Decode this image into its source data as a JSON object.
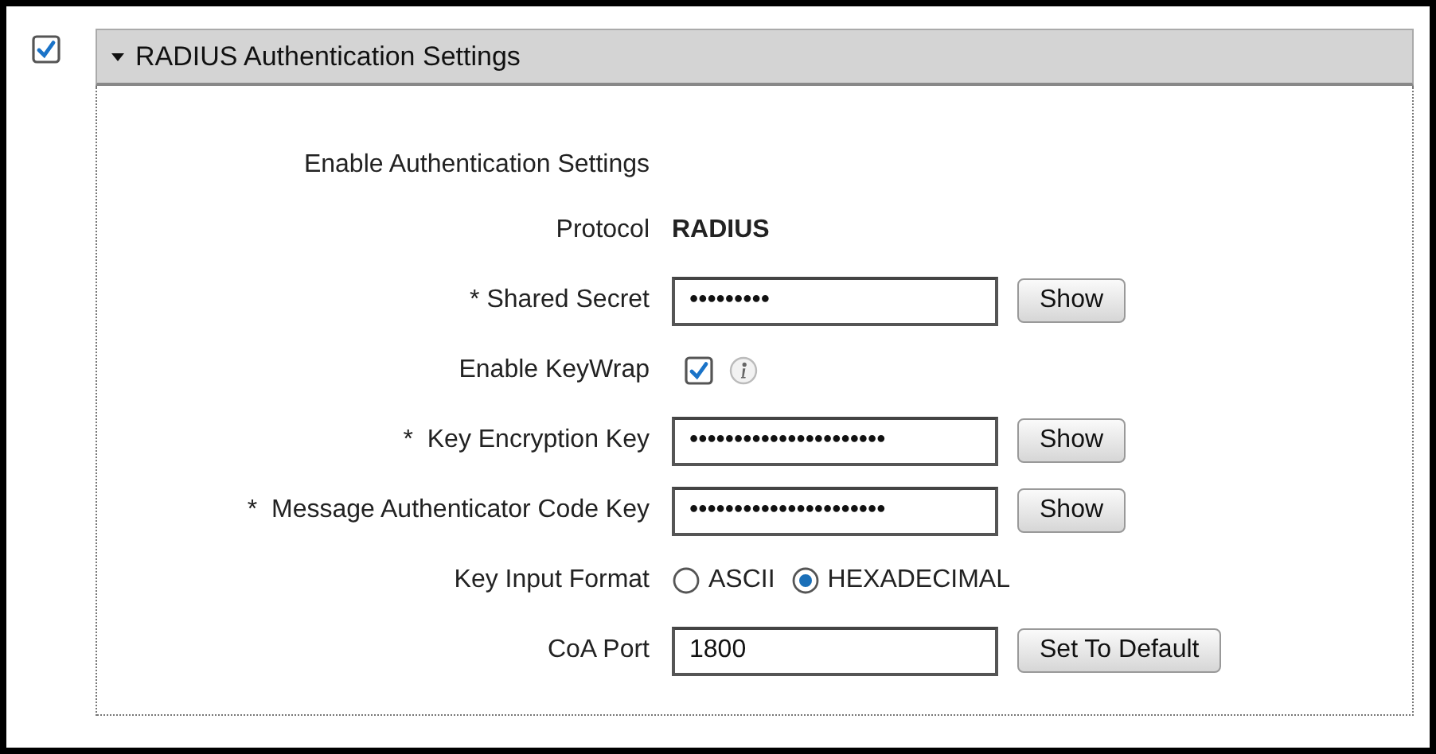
{
  "enable_checkbox": {
    "checked": true
  },
  "section": {
    "title": "RADIUS Authentication Settings",
    "expanded": true
  },
  "rows": [
    {
      "kind": "heading",
      "label": "Enable Authentication Settings"
    },
    {
      "kind": "static",
      "label": "Protocol",
      "value": "RADIUS"
    },
    {
      "kind": "field",
      "label": "* Shared Secret",
      "value": "•••••••••",
      "button": "Show"
    },
    {
      "kind": "checkbox",
      "label": "Enable KeyWrap",
      "checked": true
    },
    {
      "kind": "field",
      "label": "*  Key Encryption Key",
      "value": "••••••••••••••••••••••",
      "button": "Show"
    },
    {
      "kind": "field",
      "label": "*  Message Authenticator Code Key",
      "value": "••••••••••••••••••••••",
      "button": "Show"
    },
    {
      "kind": "radio",
      "label": "Key Input Format",
      "options": [
        {
          "label": "ASCII",
          "selected": false
        },
        {
          "label": "HEXADECIMAL",
          "selected": true
        }
      ]
    },
    {
      "kind": "field",
      "label": "CoA Port",
      "value": "1800",
      "button": "Set To Default"
    }
  ]
}
